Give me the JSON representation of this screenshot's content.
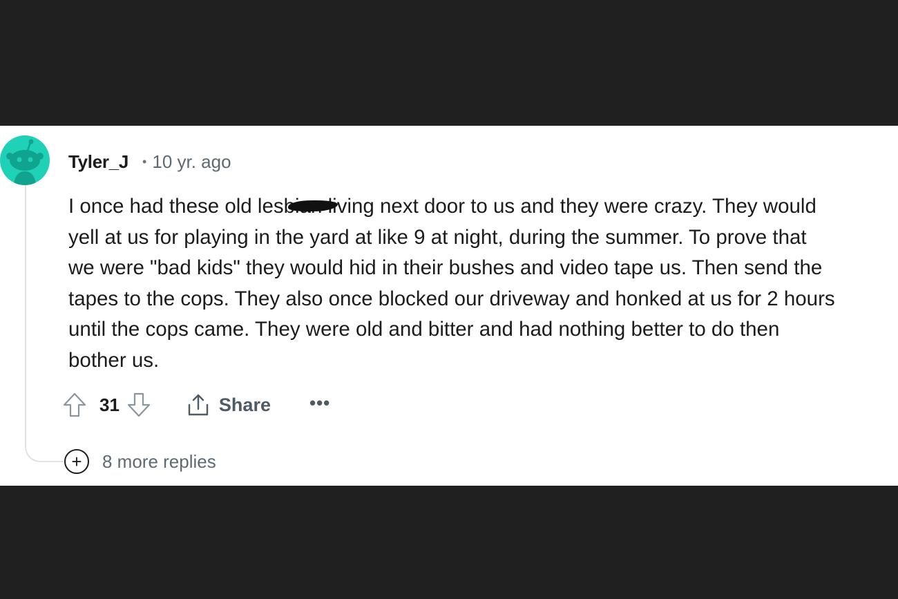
{
  "comment": {
    "author": "Tyler_J",
    "separator": "•",
    "timestamp": "10 yr. ago",
    "body_lines": [
      "I once had these old les",
      "living next door to us and they were crazy. They would",
      "yell at us for playing in the yard at like 9 at night, during the summer. To prove that",
      "we were \"bad kids\" they would hid in their bushes and video tape us. Then send the",
      "tapes to the cops. They also once blocked our driveway and honked at us for 2 hours",
      "until the cops came. They were old and bitter and had nothing better to do then",
      "bother us."
    ],
    "redacted_fragment": "bian",
    "vote_count": "31",
    "share_label": "Share",
    "more_label": "•••",
    "replies_label": "8 more replies",
    "replies_icon": "+"
  },
  "icons": {
    "avatar": "reddit-snoo-avatar",
    "upvote": "arrow-up-outline-icon",
    "downvote": "arrow-down-outline-icon",
    "share": "share-upload-icon",
    "more": "ellipsis-icon",
    "expand": "plus-circle-icon"
  },
  "colors": {
    "avatar_bg": "#1fd1b6",
    "avatar_figure": "#10a38d",
    "background_dark": "#202020",
    "panel_bg": "#ffffff",
    "text_primary": "#1c1c1c",
    "text_meta": "#5c6a73",
    "icon_gray": "#4f5b63",
    "thread_line": "#dfe3e6"
  }
}
